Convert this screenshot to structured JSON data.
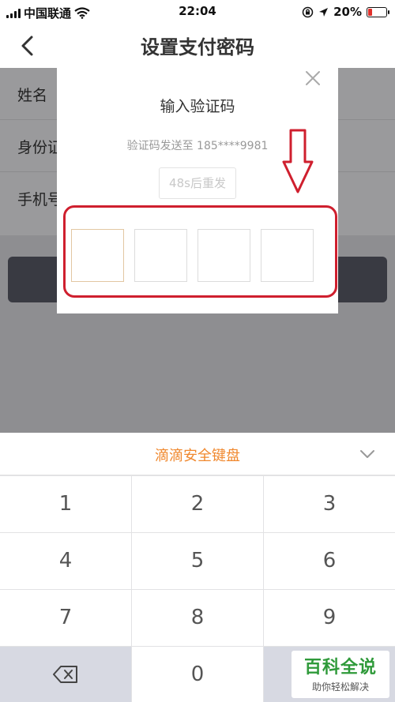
{
  "status_bar": {
    "carrier": "中国联通",
    "time": "22:04",
    "battery": "20%",
    "battery_level": 0.2
  },
  "nav": {
    "title": "设置支付密码"
  },
  "form": {
    "rows": [
      {
        "label": "姓名"
      },
      {
        "label": "身份证"
      },
      {
        "label": "手机号"
      }
    ]
  },
  "dialog": {
    "title": "输入验证码",
    "description": "验证码发送至 185****9981",
    "resend_label": "48s后重发",
    "code_digits": [
      "",
      "",
      "",
      ""
    ]
  },
  "keyboard": {
    "title": "滴滴安全键盘",
    "keys": [
      "1",
      "2",
      "3",
      "4",
      "5",
      "6",
      "7",
      "8",
      "9",
      "0"
    ]
  },
  "colors": {
    "accent": "#f0882e",
    "highlight": "#cf1f2e",
    "overlay": "#9a9a9c",
    "submit_button": "#393a42"
  },
  "watermark": {
    "main": "百科全说",
    "sub": "助你轻松解决"
  }
}
